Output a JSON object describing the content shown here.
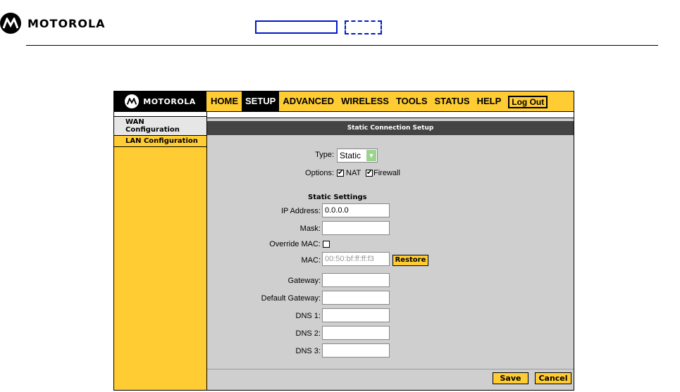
{
  "header": {
    "brand": "MOTOROLA"
  },
  "frame": {
    "brand": "MOTOROLA",
    "nav": [
      "HOME",
      "SETUP",
      "ADVANCED",
      "WIRELESS",
      "TOOLS",
      "STATUS",
      "HELP"
    ],
    "active_nav": "SETUP",
    "logout_label": "Log Out"
  },
  "sidebar": {
    "items": [
      {
        "label": "WAN Configuration"
      },
      {
        "label": "LAN Configuration"
      }
    ]
  },
  "main": {
    "title": "Static Connection Setup",
    "type_label": "Type:",
    "type_value": "Static",
    "options_label": "Options:",
    "nat_label": "NAT",
    "firewall_label": "Firewall",
    "section_title": "Static Settings",
    "fields": {
      "ip_label": "IP Address:",
      "ip_value": "0.0.0.0",
      "mask_label": "Mask:",
      "mask_value": "",
      "override_label": "Override MAC:",
      "mac_label": "MAC:",
      "mac_value": "00:50:bf:ff:ff:f3",
      "restore_label": "Restore",
      "gateway_label": "Gateway:",
      "gateway_value": "",
      "default_gateway_label": "Default Gateway:",
      "default_gateway_value": "",
      "dns1_label": "DNS 1:",
      "dns1_value": "",
      "dns2_label": "DNS 2:",
      "dns2_value": "",
      "dns3_label": "DNS 3:",
      "dns3_value": ""
    },
    "save_label": "Save",
    "cancel_label": "Cancel"
  },
  "colors": {
    "accent": "#ffcc33",
    "panel": "#cfcfcf",
    "title_bar": "#444444",
    "frame_blue": "#0018c8"
  }
}
